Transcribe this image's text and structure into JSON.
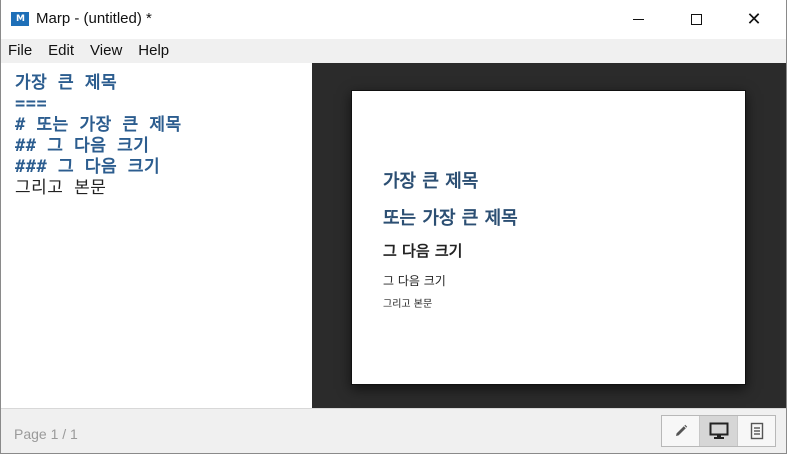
{
  "window": {
    "title": "Marp - (untitled) *",
    "app_icon_text": "M"
  },
  "window_controls": {
    "minimize": "minimize",
    "maximize": "maximize",
    "close": "✕"
  },
  "menubar": {
    "items": [
      {
        "label": "File"
      },
      {
        "label": "Edit"
      },
      {
        "label": "View"
      },
      {
        "label": "Help"
      }
    ]
  },
  "editor": {
    "lines": [
      {
        "text": "가장 큰 제목",
        "style": "heading"
      },
      {
        "text": "===",
        "style": "marker"
      },
      {
        "text": "# 또는 가장 큰 제목",
        "style": "heading"
      },
      {
        "text": "## 그 다음 크기",
        "style": "heading"
      },
      {
        "text": "### 그 다음 크기",
        "style": "heading"
      },
      {
        "text": "그리고 본문",
        "style": "plain"
      }
    ]
  },
  "preview": {
    "h1": "가장 큰 제목",
    "h1b": "또는 가장 큰 제목",
    "h2": "그 다음 크기",
    "h3": "그 다음 크기",
    "body": "그리고 본문"
  },
  "statusbar": {
    "page_indicator": "Page 1 / 1",
    "view_modes": [
      {
        "icon": "pencil-icon",
        "active": false
      },
      {
        "icon": "monitor-icon",
        "active": true
      },
      {
        "icon": "document-icon",
        "active": false
      }
    ]
  }
}
